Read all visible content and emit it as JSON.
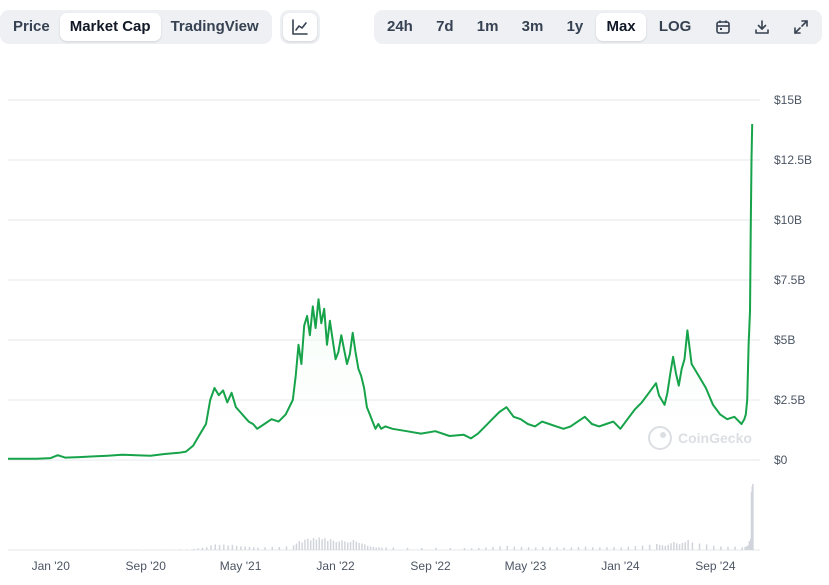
{
  "tabs": [
    {
      "label": "Price",
      "active": false
    },
    {
      "label": "Market Cap",
      "active": true
    },
    {
      "label": "TradingView",
      "active": false
    }
  ],
  "chart_type_icon": "line-chart-icon",
  "ranges": [
    {
      "label": "24h",
      "active": false
    },
    {
      "label": "7d",
      "active": false
    },
    {
      "label": "1m",
      "active": false
    },
    {
      "label": "3m",
      "active": false
    },
    {
      "label": "1y",
      "active": false
    },
    {
      "label": "Max",
      "active": true
    },
    {
      "label": "LOG",
      "active": false
    }
  ],
  "toolbar_icons": [
    "calendar-icon",
    "download-icon",
    "expand-icon"
  ],
  "watermark": "CoinGecko",
  "colors": {
    "line": "#16a34a",
    "area_top": "#dcf5e3",
    "grid": "#e5e7eb",
    "volume": "#d1d5db"
  },
  "chart_data": {
    "type": "area",
    "title": "",
    "xlabel": "",
    "ylabel": "",
    "y_ticks": [
      "$0",
      "$2.5B",
      "$5B",
      "$7.5B",
      "$10B",
      "$12.5B",
      "$15B"
    ],
    "ylim": [
      0,
      15
    ],
    "y_unit": "B USD",
    "x_ticks": [
      {
        "label": "Jan '20",
        "t": 2020.0
      },
      {
        "label": "Sep '20",
        "t": 2020.667
      },
      {
        "label": "May '21",
        "t": 2021.333
      },
      {
        "label": "Jan '22",
        "t": 2022.0
      },
      {
        "label": "Sep '22",
        "t": 2022.667
      },
      {
        "label": "May '23",
        "t": 2023.333
      },
      {
        "label": "Jan '24",
        "t": 2024.0
      },
      {
        "label": "Sep '24",
        "t": 2024.667
      }
    ],
    "xlim": [
      2019.7,
      2024.98
    ],
    "grid": true,
    "series": [
      {
        "x": [
          2019.7,
          2019.8,
          2019.9,
          2020.0,
          2020.05,
          2020.1,
          2020.2,
          2020.3,
          2020.4,
          2020.5,
          2020.6,
          2020.7,
          2020.8,
          2020.9,
          2020.95,
          2021.0,
          2021.03,
          2021.06,
          2021.09,
          2021.12,
          2021.15,
          2021.18,
          2021.21,
          2021.24,
          2021.27,
          2021.3,
          2021.33,
          2021.36,
          2021.39,
          2021.42,
          2021.45,
          2021.5,
          2021.55,
          2021.6,
          2021.65,
          2021.7,
          2021.72,
          2021.74,
          2021.76,
          2021.78,
          2021.8,
          2021.82,
          2021.84,
          2021.86,
          2021.88,
          2021.9,
          2021.92,
          2021.94,
          2021.96,
          2021.98,
          2022.0,
          2022.02,
          2022.04,
          2022.06,
          2022.08,
          2022.1,
          2022.12,
          2022.14,
          2022.16,
          2022.18,
          2022.2,
          2022.22,
          2022.24,
          2022.26,
          2022.28,
          2022.3,
          2022.32,
          2022.35,
          2022.4,
          2022.5,
          2022.6,
          2022.7,
          2022.8,
          2022.9,
          2022.95,
          2023.0,
          2023.05,
          2023.1,
          2023.15,
          2023.2,
          2023.25,
          2023.3,
          2023.35,
          2023.4,
          2023.45,
          2023.5,
          2023.55,
          2023.6,
          2023.65,
          2023.7,
          2023.75,
          2023.8,
          2023.85,
          2023.9,
          2023.95,
          2024.0,
          2024.05,
          2024.1,
          2024.15,
          2024.2,
          2024.25,
          2024.27,
          2024.29,
          2024.31,
          2024.33,
          2024.35,
          2024.37,
          2024.39,
          2024.41,
          2024.43,
          2024.45,
          2024.47,
          2024.5,
          2024.55,
          2024.6,
          2024.65,
          2024.7,
          2024.75,
          2024.8,
          2024.85,
          2024.87,
          2024.88,
          2024.89,
          2024.9,
          2024.91,
          2024.915,
          2024.92,
          2024.925
        ],
        "y": [
          0.05,
          0.05,
          0.05,
          0.08,
          0.2,
          0.1,
          0.12,
          0.15,
          0.18,
          0.22,
          0.2,
          0.18,
          0.25,
          0.3,
          0.35,
          0.6,
          0.9,
          1.2,
          1.5,
          2.5,
          3.0,
          2.7,
          2.9,
          2.4,
          2.8,
          2.2,
          2.0,
          1.8,
          1.6,
          1.5,
          1.3,
          1.5,
          1.7,
          1.6,
          1.9,
          2.5,
          3.5,
          4.8,
          4.0,
          5.6,
          6.0,
          5.2,
          6.4,
          5.5,
          6.7,
          5.7,
          6.3,
          4.8,
          5.8,
          5.0,
          4.2,
          4.5,
          5.2,
          4.6,
          4.0,
          4.4,
          5.3,
          4.5,
          3.8,
          3.5,
          3.0,
          2.2,
          1.9,
          1.6,
          1.3,
          1.5,
          1.3,
          1.4,
          1.3,
          1.2,
          1.1,
          1.2,
          1.0,
          1.05,
          0.9,
          1.1,
          1.4,
          1.7,
          2.0,
          2.2,
          1.8,
          1.7,
          1.5,
          1.4,
          1.6,
          1.5,
          1.4,
          1.3,
          1.4,
          1.6,
          1.8,
          1.5,
          1.4,
          1.5,
          1.6,
          1.3,
          1.7,
          2.1,
          2.4,
          2.8,
          3.2,
          2.7,
          2.5,
          2.3,
          2.8,
          3.6,
          4.3,
          3.6,
          3.1,
          3.8,
          4.2,
          5.4,
          4.0,
          3.5,
          3.0,
          2.3,
          1.9,
          1.7,
          1.8,
          1.5,
          1.7,
          1.9,
          2.5,
          4.8,
          6.2,
          9.5,
          12.5,
          14.0
        ]
      }
    ],
    "volume_note": "faint volume bars below chart, units not labeled"
  }
}
